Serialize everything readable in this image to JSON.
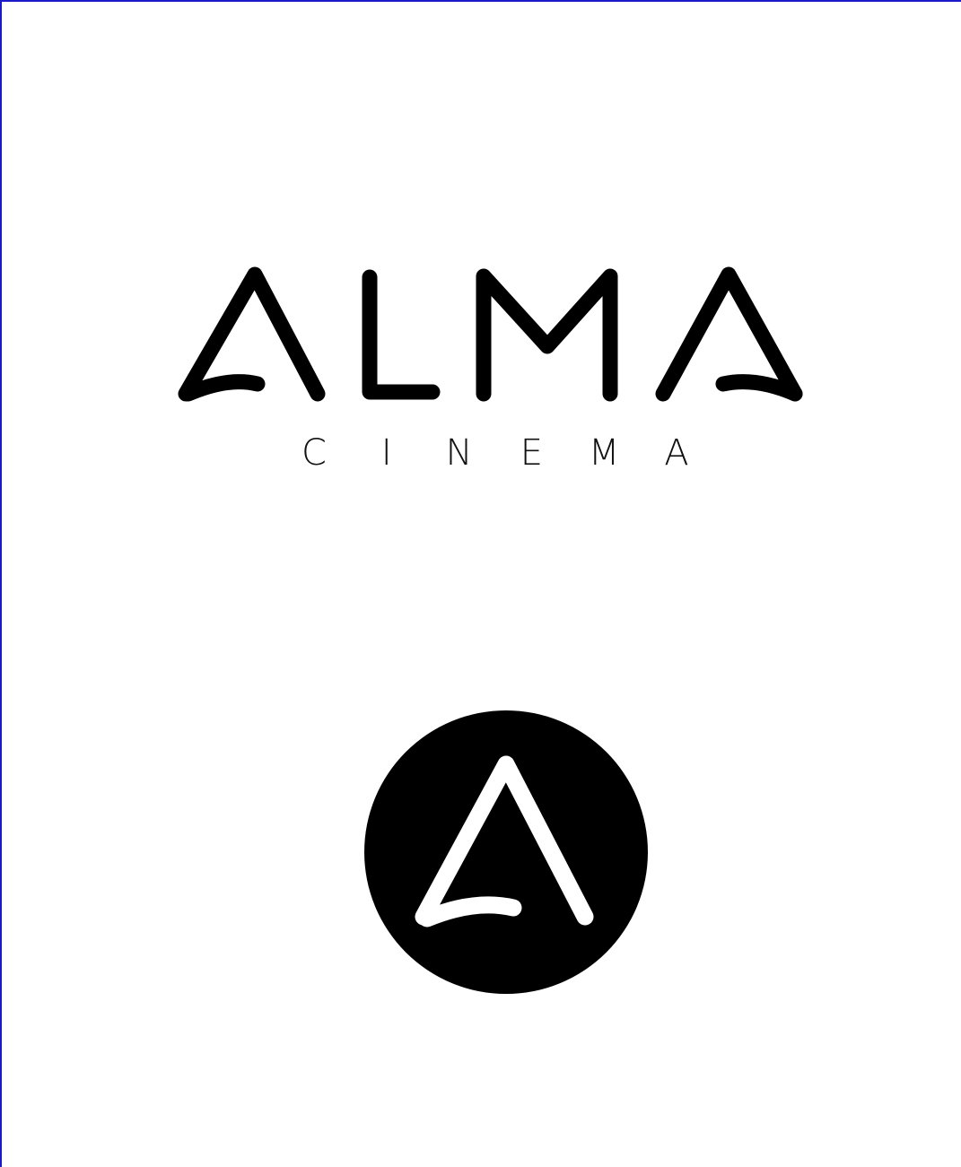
{
  "logo": {
    "wordmark": "ALMA",
    "subtitle_letters": [
      "C",
      "I",
      "N",
      "E",
      "M",
      "A"
    ],
    "subtitle": "CINEMA",
    "emblem_icon": "alma-a-emblem-icon"
  },
  "colors": {
    "ink": "#000000",
    "background": "#ffffff",
    "frame": "#1a1ac8"
  }
}
